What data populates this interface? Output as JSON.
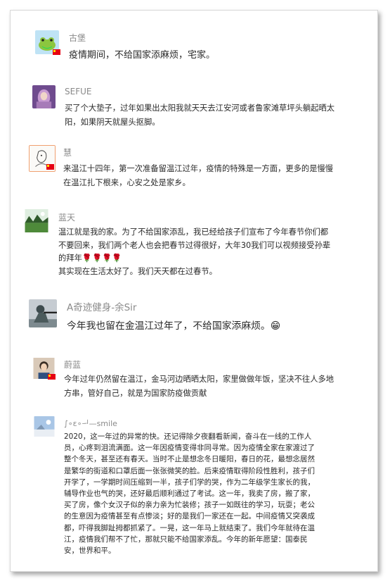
{
  "comments": [
    {
      "name": "古堡",
      "lines": [
        "疫情期间，不给国家添麻烦，宅家。"
      ]
    },
    {
      "name": "SEFUE",
      "lines": [
        "买了个大垫子，过年如果出太阳我就天天去江安河或者鲁家滩草坪头躺起晒太",
        "阳，如果阴天就屋头抠脚。"
      ]
    },
    {
      "name": "慧",
      "lines": [
        "来温江十四年，第一次准备留温江过年，疫情的特殊是一方面，更多的是慢慢",
        "在温江扎下根来，心安之处是家乡。"
      ]
    },
    {
      "name": "蓝天",
      "lines": [
        "温江就是我的家。为了不给国家添乱，我已经给孩子们宣布了今年春节你们都",
        "不要回来，我们两个老人也会把春节过得很好，大年30我们可以视频接受孙辈",
        "的拜年🌹🌹🌹🌹",
        "其实现在生活太好了。我们天天都在过春节。"
      ]
    },
    {
      "name": "A奇迹健身-余Sir",
      "lines": [
        "今年我也留在金温江过年了，不给国家添麻烦。😁"
      ]
    },
    {
      "name": "蔚蓝",
      "lines": [
        "今年过年仍然留在温江，金马河边晒晒太阳，家里做做年饭，坚决不往人多地",
        "方串，管好自己，就是为国家防疫做贡献"
      ]
    },
    {
      "name": "∫∘ε∘ᅴ—smile",
      "lines": [
        "2020，这一年过的异常的快。还记得除夕夜翻看新闻，奋斗在一线的工作人",
        "员，心疼到泪流满面。这一年因疫情变得非同寻常。因为疫情全家在家渡过了",
        "整个冬天，甚至还有春天。当时不止是想念冬日暖阳，春日的花，最想念居然",
        "是繁华的街道和口罩后面一张张微笑的脸。后来疫情取得阶段性胜利，孩子们",
        "开学了，一学期时间压缩到一半，孩子们学的哭，作为二年级学生家长的我，",
        "辅导作业也气的哭，还好最后顺利通过了考试。这一年，我卖了房，搬了家，",
        "买了房，像个女汉子似的亲力亲为忙装修；孩子一如既往的学习，玩耍；老公",
        "的生意因为疫情甚至有点惨淡；好的是我们一家还在一起。中间疫情又突袭成",
        "都，吓得我脚趾拇都抓紧了。一晃，这一年马上就结束了。我们今年就待在温",
        "江，疫情我们帮不了忙，那就只能不给国家添乱。今年的新年愿望：国泰民",
        "安，世界和平。"
      ]
    }
  ],
  "icons": [
    "frog-avatar-icon",
    "purple-hair-avatar-icon",
    "sketch-avatar-icon",
    "landscape-avatar-icon",
    "soldier-avatar-icon",
    "boy-avatar-icon",
    "sky-avatar-icon",
    "china-flag-icon"
  ],
  "colors": {
    "name": "#8a8a8a",
    "text": "#2a2a2a",
    "flag": "#e60012",
    "border": "#d8d8d8"
  }
}
